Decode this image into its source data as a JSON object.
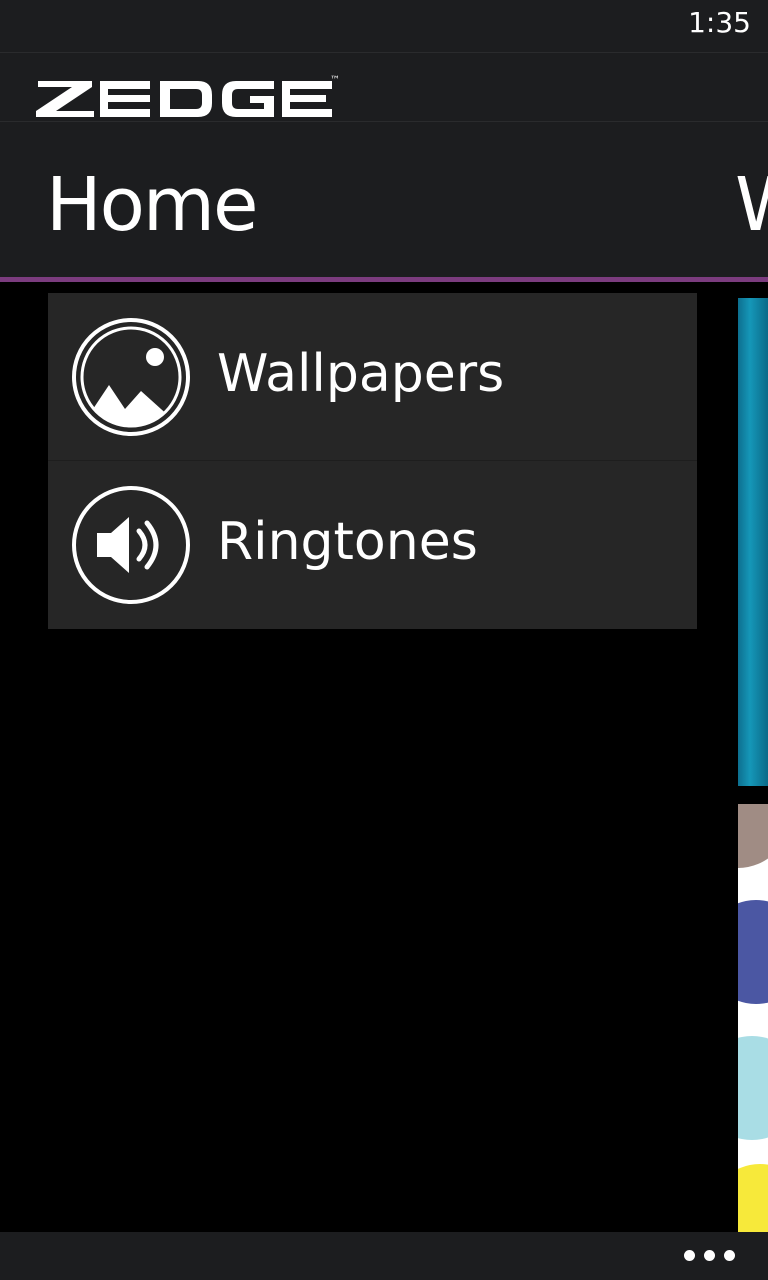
{
  "status_bar": {
    "time": "1:35"
  },
  "header": {
    "logo_text": "ZEDGE",
    "logo_trademark": "™"
  },
  "pivot": {
    "current": "Home",
    "next_peek": "W",
    "accent_color": "#7b3c7e"
  },
  "menu": {
    "items": [
      {
        "label": "Wallpapers",
        "icon": "wallpaper-icon"
      },
      {
        "label": "Ringtones",
        "icon": "speaker-icon"
      }
    ]
  },
  "app_bar": {
    "more_icon": "more-ellipsis-icon"
  },
  "colors": {
    "background": "#000000",
    "chrome": "#1c1d1f",
    "panel": "#262626",
    "preview_teal": "#1597b8",
    "dot_taupe": "#a08c84",
    "dot_indigo": "#4b57a3",
    "dot_lightblue": "#a9dde5",
    "dot_yellow": "#f7e93a"
  }
}
